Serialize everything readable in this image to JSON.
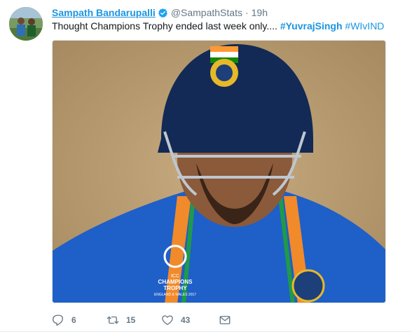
{
  "tweet": {
    "author_name": "Sampath Bandarupalli",
    "handle": "@SampathStats",
    "separator": "·",
    "time": "19h",
    "text_prefix": "Thought Champions Trophy ended last week only....",
    "hashtag_primary": "#YuvrajSingh",
    "hashtag_secondary": "#WIvIND",
    "media": {
      "helmet_flag": "tricolour",
      "jersey_text_line1": "ICC",
      "jersey_text_line2": "CHAMPIONS",
      "jersey_text_line3": "TROPHY",
      "jersey_text_line4": "ENGLAND & WALES 2017"
    }
  },
  "actions": {
    "reply_count": "6",
    "retweet_count": "15",
    "like_count": "43"
  },
  "colors": {
    "link": "#1b95e0",
    "muted": "#657786",
    "verified": "#1da1f2"
  }
}
